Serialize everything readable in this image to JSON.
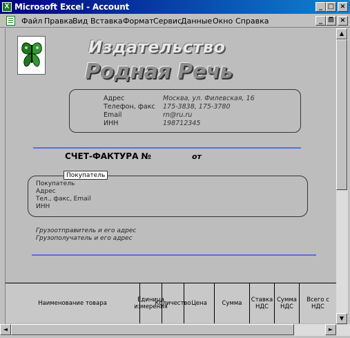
{
  "window": {
    "title": "Microsoft Excel - Account",
    "app_icon": "X",
    "controls": [
      "_",
      "□",
      "×"
    ]
  },
  "menu": {
    "items": [
      "Файл",
      "Правка",
      "Вид",
      "Вставка",
      "Формат",
      "Сервис",
      "Данные",
      "Окно",
      "Справка"
    ],
    "mdi_controls": [
      "_",
      "ᗰ",
      "×"
    ]
  },
  "document": {
    "brand_line1": "Издательство",
    "brand_line2": "Родная Речь",
    "contacts": [
      {
        "label": "Адрес",
        "value": "Москва, ул. Филевская, 16"
      },
      {
        "label": "Телефон, факс",
        "value": "175-3838, 175-3780"
      },
      {
        "label": "Email",
        "value": "rn@ru.ru"
      },
      {
        "label": "ИНН",
        "value": "198712345"
      }
    ],
    "invoice_title": "СЧЕТ-ФАКТУРА №",
    "invoice_from": "от",
    "buyer_tag": "Покупатель",
    "buyer_lines": [
      "Покупатель",
      "Адрес",
      "Тел., факс, Email",
      "ИНН"
    ],
    "shipping": [
      "Грузоотправитель и его адрес",
      "Грузополучатель и его адрес"
    ]
  },
  "table": {
    "headers": [
      "Наименование товара",
      "Единица измерения",
      "Количество",
      "Цена",
      "Сумма",
      "Ставка НДС",
      "Сумма НДС",
      "Всего с НДС"
    ]
  },
  "scroll": {
    "up": "▲",
    "down": "▼",
    "left": "◄",
    "right": "►"
  },
  "colors": {
    "titlebar": "#000080",
    "rule": "#5a6fd8",
    "logo": "#1a7a1a"
  }
}
